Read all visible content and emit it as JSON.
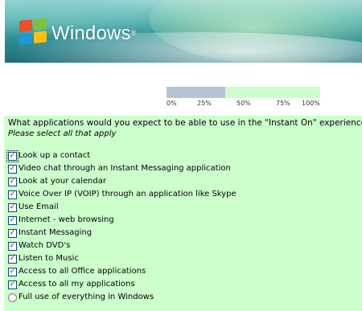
{
  "banner": {
    "brand": "Windows",
    "trademark": "®"
  },
  "progress": {
    "fraction": 0.38,
    "ticks": [
      "0%",
      "25%",
      "50%",
      "75%",
      "100%"
    ],
    "fill_color": "#b8c4d4",
    "track_color": "#ccffcc"
  },
  "question": {
    "text": "What applications would you expect to be able to use in the \"Instant On\" experience?",
    "instruction": "Please select all that apply"
  },
  "options": [
    {
      "label": "Look up a contact",
      "type": "checkbox",
      "checked": true
    },
    {
      "label": "Video chat through an Instant Messaging application",
      "type": "checkbox",
      "checked": true
    },
    {
      "label": "Look at your calendar",
      "type": "checkbox",
      "checked": true
    },
    {
      "label": "Voice Over IP (VOIP) through an application like Skype",
      "type": "checkbox",
      "checked": true
    },
    {
      "label": "Use Email",
      "type": "checkbox",
      "checked": true
    },
    {
      "label": "Internet - web browsing",
      "type": "checkbox",
      "checked": true
    },
    {
      "label": "Instant Messaging",
      "type": "checkbox",
      "checked": true
    },
    {
      "label": "Watch DVD's",
      "type": "checkbox",
      "checked": true
    },
    {
      "label": "Listen to Music",
      "type": "checkbox",
      "checked": true
    },
    {
      "label": "Access to all Office applications",
      "type": "checkbox",
      "checked": true
    },
    {
      "label": "Access to all my applications",
      "type": "checkbox",
      "checked": true
    },
    {
      "label": "Full use of everything in Windows",
      "type": "radio",
      "checked": false
    }
  ],
  "check_glyph": "✓"
}
